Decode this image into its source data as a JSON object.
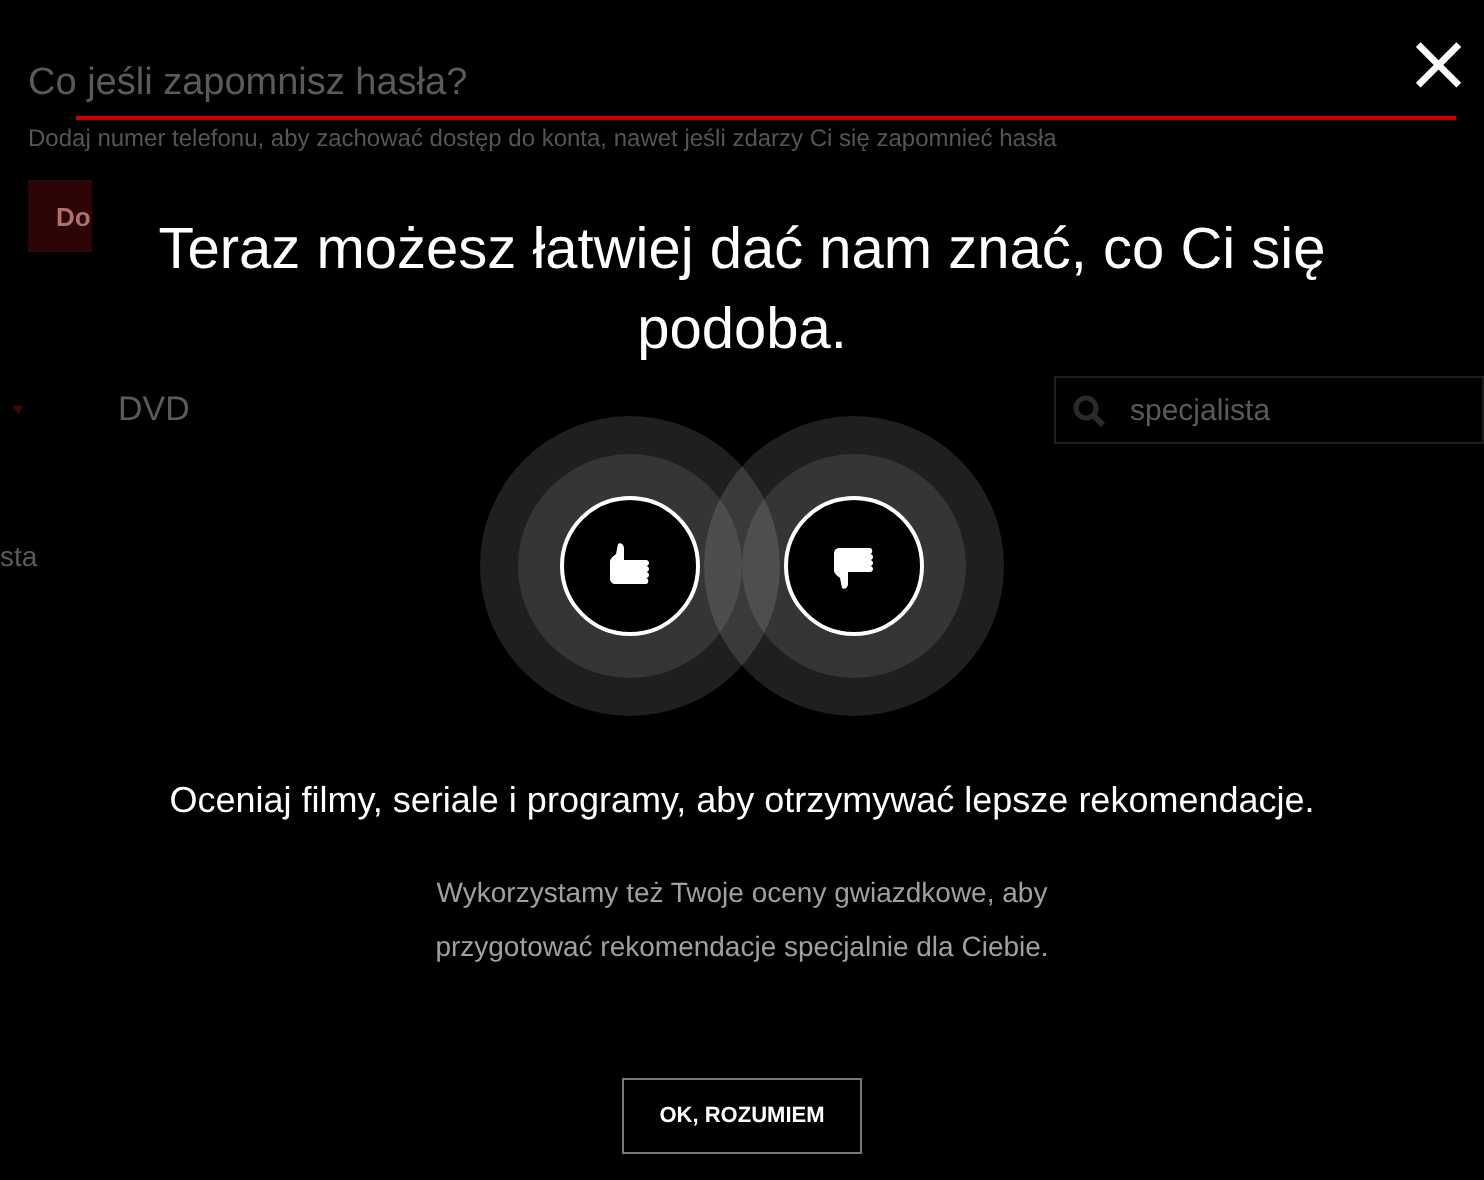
{
  "background_page": {
    "heading": "Co jeśli zapomnisz hasła?",
    "description": "Dodaj numer telefonu, aby zachować dostęp do konta, nawet jeśli zdarzy Ci się zapomnieć hasła",
    "primary_button": "Do",
    "nav_item": "DVD",
    "search": {
      "value": "specjalista"
    },
    "list_text": "sta"
  },
  "dialog": {
    "close": "×",
    "title": "Teraz możesz łatwiej dać nam znać, co Ci się podoba.",
    "rating_buttons": [
      {
        "kind": "up"
      },
      {
        "kind": "down"
      }
    ],
    "subtitle": "Oceniaj filmy, seriale i programy, aby otrzymywać lepsze rekomendacje.",
    "note": "Wykorzystamy też Twoje oceny gwiazdkowe, aby przygotować rekomendacje specjalnie dla Ciebie.",
    "button": "OK, ROZUMIEM"
  }
}
